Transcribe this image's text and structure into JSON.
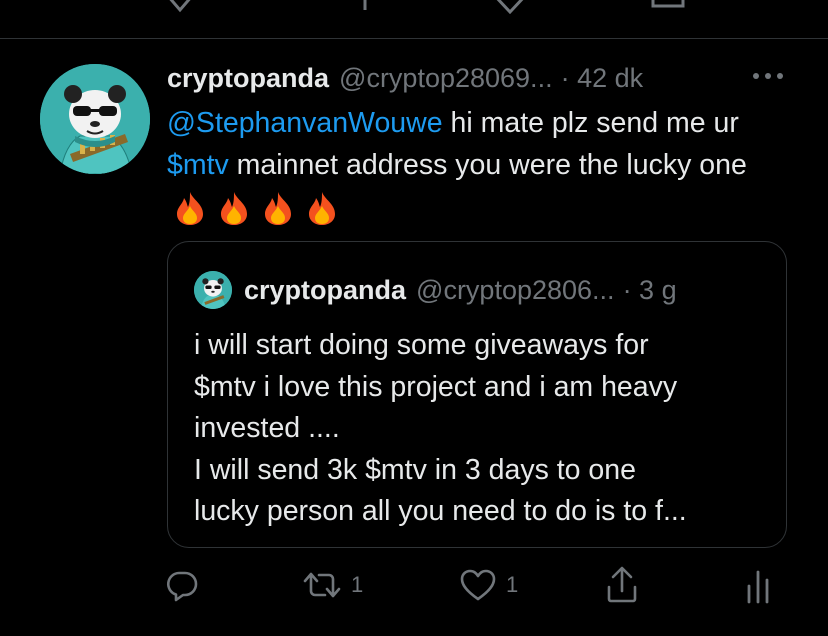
{
  "tweet": {
    "display_name": "cryptopanda",
    "handle": "@cryptop28069...",
    "time": "· 42 dk",
    "text_mention": "@StephanvanWouwe",
    "text_part1": " hi mate plz send me ur ",
    "text_cashtag": "$mtv",
    "text_part2": " mainnet address you were the lucky one",
    "emoji": [
      "fire",
      "fire",
      "fire",
      "fire"
    ]
  },
  "quoted_tweet": {
    "display_name": "cryptopanda",
    "handle": "@cryptop2806...",
    "time": "· 3 g",
    "lines": [
      "i will start doing some giveaways for",
      "$mtv i love this project and i am heavy",
      "invested ....",
      "I will send 3k $mtv in 3 days to one",
      "lucky person all you need to do is to f..."
    ]
  },
  "actions": {
    "reply_icon": "reply-icon",
    "retweet_count": "1",
    "like_count": "1",
    "share_icon": "share-icon",
    "analytics_icon": "analytics-icon"
  },
  "colors": {
    "background": "#000000",
    "text": "#e7e9ea",
    "secondary": "#71767b",
    "link": "#1d9bf0",
    "avatar_bg": "#3bb0ad"
  }
}
